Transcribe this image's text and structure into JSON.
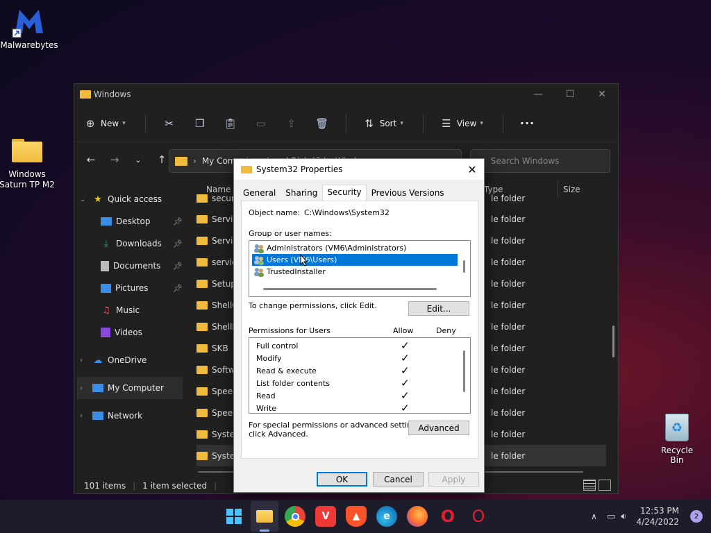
{
  "desktop": {
    "icons": [
      {
        "label": "Malwarebytes"
      },
      {
        "label": "Windows Saturn TP M2"
      },
      {
        "label": "Recycle Bin"
      }
    ]
  },
  "explorer": {
    "title": "Windows",
    "toolbar": {
      "new_label": "New",
      "sort_label": "Sort",
      "view_label": "View",
      "more_label": "···"
    },
    "address": "My Computer  ›  Local Disk (C:)  ›  Windows",
    "search_placeholder": "Search Windows",
    "columns": {
      "name": "Name",
      "type": "Type",
      "size": "Size"
    },
    "sidebar": [
      {
        "label": "Quick access",
        "icon": "star-icon"
      },
      {
        "label": "Desktop",
        "icon": "desktop-icon",
        "pinned": true
      },
      {
        "label": "Downloads",
        "icon": "download-icon",
        "pinned": true
      },
      {
        "label": "Documents",
        "icon": "document-icon",
        "pinned": true
      },
      {
        "label": "Pictures",
        "icon": "picture-icon",
        "pinned": true
      },
      {
        "label": "Music",
        "icon": "music-icon"
      },
      {
        "label": "Videos",
        "icon": "video-icon"
      },
      {
        "label": "OneDrive",
        "icon": "cloud-icon"
      },
      {
        "label": "My Computer",
        "icon": "computer-icon"
      },
      {
        "label": "Network",
        "icon": "network-icon"
      }
    ],
    "files": [
      {
        "name": "secur",
        "type": "le folder"
      },
      {
        "name": "Servic",
        "type": "le folder"
      },
      {
        "name": "Servic",
        "type": "le folder"
      },
      {
        "name": "servic",
        "type": "le folder"
      },
      {
        "name": "Setup",
        "type": "le folder"
      },
      {
        "name": "ShellC",
        "type": "le folder"
      },
      {
        "name": "ShellE",
        "type": "le folder"
      },
      {
        "name": "SKB",
        "type": "le folder"
      },
      {
        "name": "Softw",
        "type": "le folder"
      },
      {
        "name": "Speec",
        "type": "le folder"
      },
      {
        "name": "Speec",
        "type": "le folder"
      },
      {
        "name": "Syster",
        "type": "le folder"
      },
      {
        "name": "Syster",
        "type": "le folder"
      }
    ],
    "status": {
      "items": "101 items",
      "selected": "1 item selected"
    }
  },
  "dialog": {
    "title": "System32 Properties",
    "tabs": [
      "General",
      "Sharing",
      "Security",
      "Previous Versions"
    ],
    "object_name_label": "Object name:",
    "object_name_value": "C:\\Windows\\System32",
    "group_label": "Group or user names:",
    "users": [
      "Administrators (VM6\\Administrators)",
      "Users (VM6\\Users)",
      "TrustedInstaller"
    ],
    "change_text": "To change permissions, click Edit.",
    "edit_label": "Edit...",
    "perms_for": "Permissions for Users",
    "allow_label": "Allow",
    "deny_label": "Deny",
    "permissions": [
      {
        "name": "Full control",
        "allow": true
      },
      {
        "name": "Modify",
        "allow": true
      },
      {
        "name": "Read & execute",
        "allow": true
      },
      {
        "name": "List folder contents",
        "allow": true
      },
      {
        "name": "Read",
        "allow": true
      },
      {
        "name": "Write",
        "allow": true
      }
    ],
    "special_text_1": "For special permissions or advanced settings,",
    "special_text_2": "click Advanced.",
    "advanced_label": "Advanced",
    "ok_label": "OK",
    "cancel_label": "Cancel",
    "apply_label": "Apply",
    "checkmark": "✓"
  },
  "taskbar": {
    "time": "12:53 PM",
    "date": "4/24/2022",
    "notifications": "2"
  }
}
